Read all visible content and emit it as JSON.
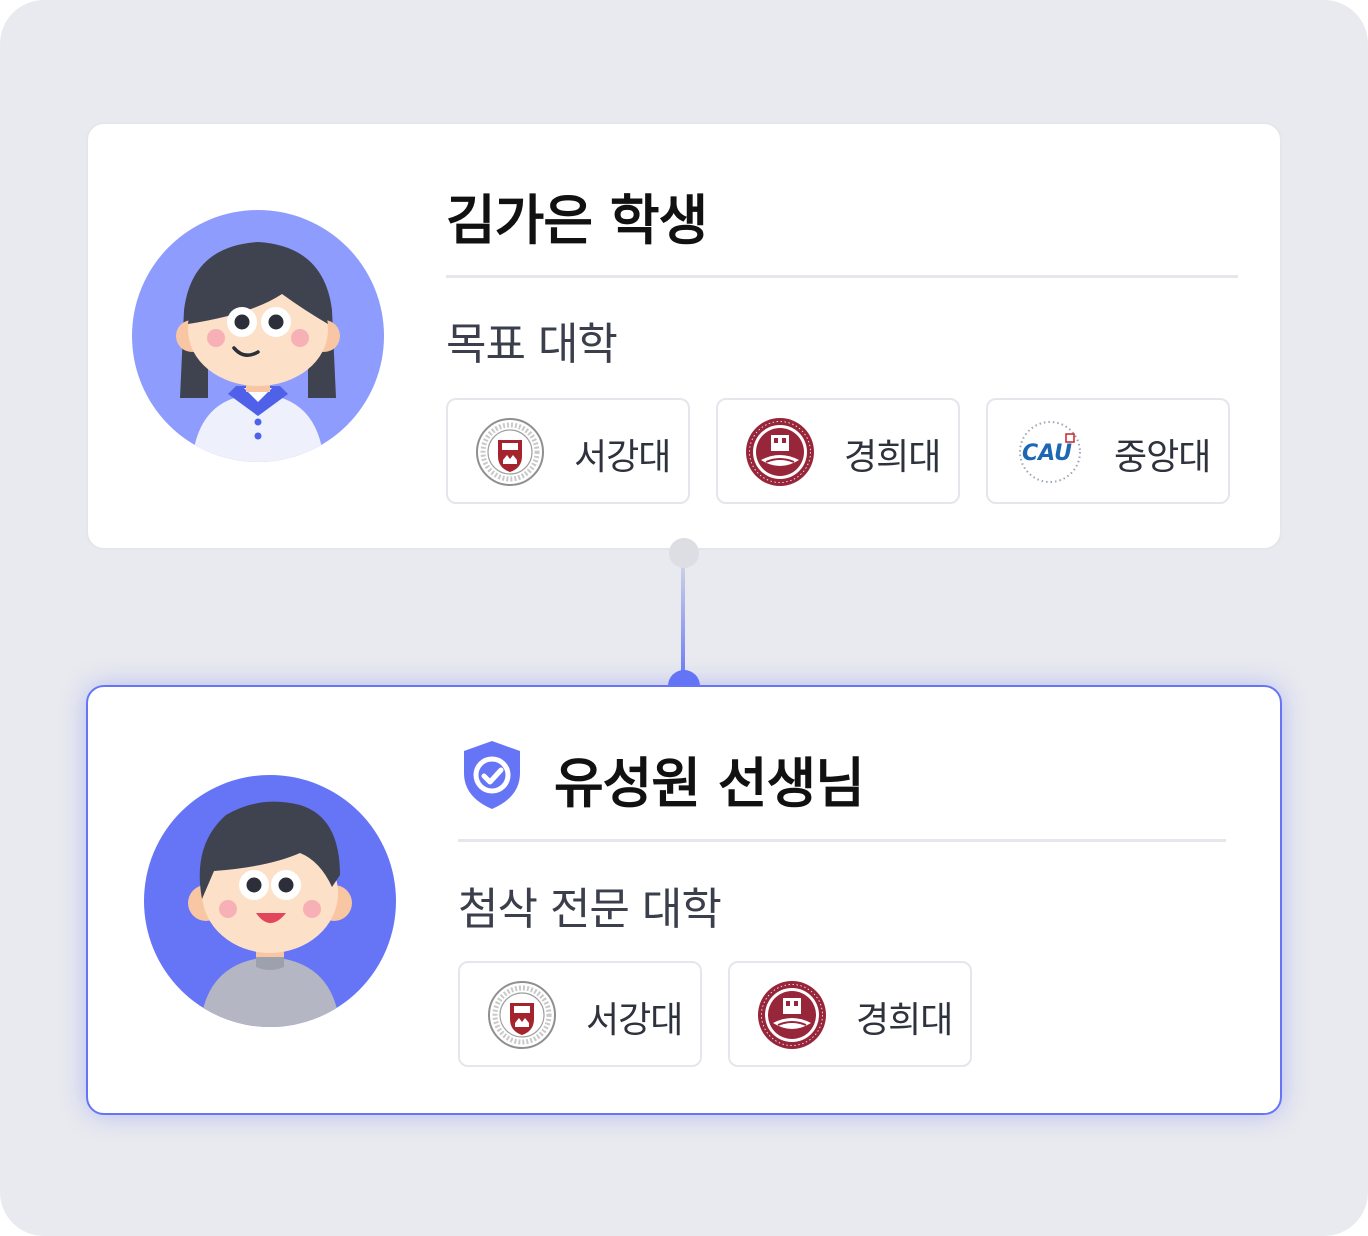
{
  "student": {
    "name": "김가은 학생",
    "section_label": "목표 대학",
    "universities": [
      {
        "label": "서강대",
        "logo": "sogang-logo"
      },
      {
        "label": "경희대",
        "logo": "kyunghee-logo"
      },
      {
        "label": "중앙대",
        "logo": "cau-logo"
      }
    ]
  },
  "teacher": {
    "name": "유성원 선생님",
    "verified_icon": "shield-check-icon",
    "section_label": "첨삭 전문 대학",
    "universities": [
      {
        "label": "서강대",
        "logo": "sogang-logo"
      },
      {
        "label": "경희대",
        "logo": "kyunghee-logo"
      }
    ]
  },
  "colors": {
    "background": "#e9eaef",
    "accent": "#6575f6",
    "student_avatar_bg": "#8e9dfd",
    "teacher_avatar_bg": "#6575f6",
    "sogang_red": "#a4232c",
    "kyunghee_maroon": "#98263a",
    "cau_blue": "#1d67b4"
  }
}
